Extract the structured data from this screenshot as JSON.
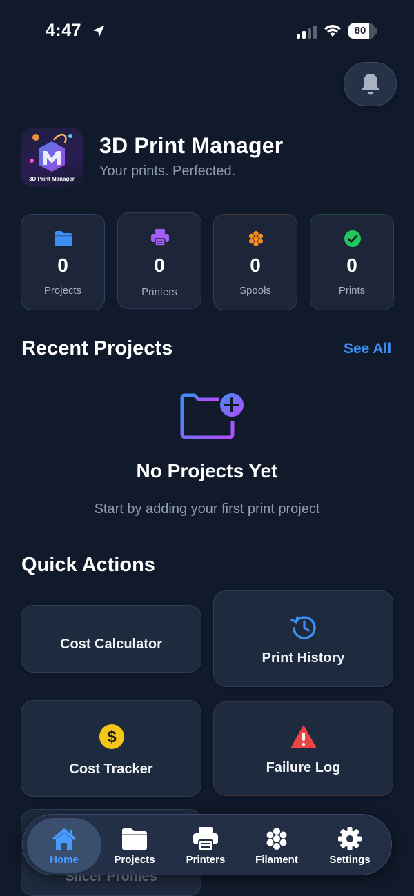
{
  "status_bar": {
    "time": "4:47",
    "battery": "80",
    "battery_level": 0.8
  },
  "header": {
    "app_title": "3D Print Manager",
    "subtitle": "Your prints. Perfected.",
    "logo_caption": "3D Print Manager"
  },
  "stats": [
    {
      "value": "0",
      "label": "Projects",
      "icon": "folder-icon",
      "color": "#3b8ff5"
    },
    {
      "value": "0",
      "label": "Printers",
      "icon": "printer-icon",
      "color": "#a25ef5"
    },
    {
      "value": "0",
      "label": "Spools",
      "icon": "spool-icon",
      "color": "#f5891f"
    },
    {
      "value": "0",
      "label": "Prints",
      "icon": "check-circle-icon",
      "color": "#22c55e"
    }
  ],
  "recent": {
    "title": "Recent Projects",
    "see_all": "See All",
    "empty_title": "No Projects Yet",
    "empty_subtitle": "Start by adding your first print project"
  },
  "quick_actions": {
    "title": "Quick Actions",
    "items": [
      {
        "label": "Cost Calculator"
      },
      {
        "label": "Print History",
        "icon": "history-icon"
      },
      {
        "label": "Cost Tracker",
        "icon": "dollar-icon"
      },
      {
        "label": "Failure Log",
        "icon": "warning-icon"
      },
      {
        "label": "Slicer Profiles"
      }
    ]
  },
  "tabs": [
    {
      "label": "Home",
      "icon": "home-icon",
      "active": true
    },
    {
      "label": "Projects",
      "icon": "folder-icon"
    },
    {
      "label": "Printers",
      "icon": "printer-icon"
    },
    {
      "label": "Filament",
      "icon": "filament-icon"
    },
    {
      "label": "Settings",
      "icon": "gear-icon"
    }
  ],
  "colors": {
    "background": "#111a2b",
    "accent": "#3b8ff5",
    "muted_text": "#8f9ab0"
  }
}
